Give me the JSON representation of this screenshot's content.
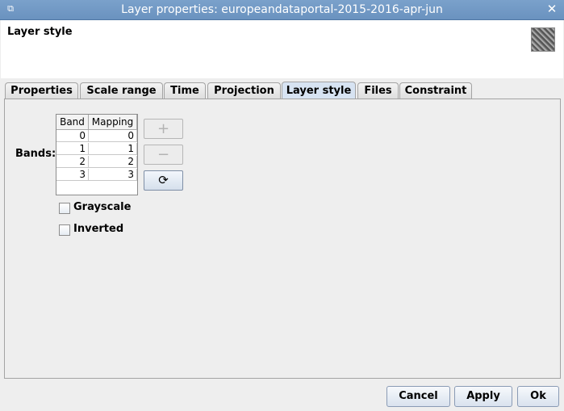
{
  "window": {
    "title": "Layer properties: europeandataportal-2015-2016-apr-jun",
    "menu_icon": "⧉",
    "close_icon": "✕"
  },
  "header": {
    "heading": "Layer style"
  },
  "tabs": [
    {
      "label": "Properties"
    },
    {
      "label": "Scale range"
    },
    {
      "label": "Time"
    },
    {
      "label": "Projection"
    },
    {
      "label": "Layer style",
      "active": true
    },
    {
      "label": "Files"
    },
    {
      "label": "Constraint"
    }
  ],
  "bands": {
    "label": "Bands:",
    "columns": [
      "Band",
      "Mapping"
    ],
    "rows": [
      [
        "0",
        "0"
      ],
      [
        "1",
        "1"
      ],
      [
        "2",
        "2"
      ],
      [
        "3",
        "3"
      ]
    ],
    "add_symbol": "+",
    "remove_symbol": "−",
    "refresh_symbol": "⟳"
  },
  "options": {
    "grayscale": "Grayscale",
    "inverted": "Inverted"
  },
  "buttons": {
    "cancel": "Cancel",
    "apply": "Apply",
    "ok": "Ok"
  }
}
